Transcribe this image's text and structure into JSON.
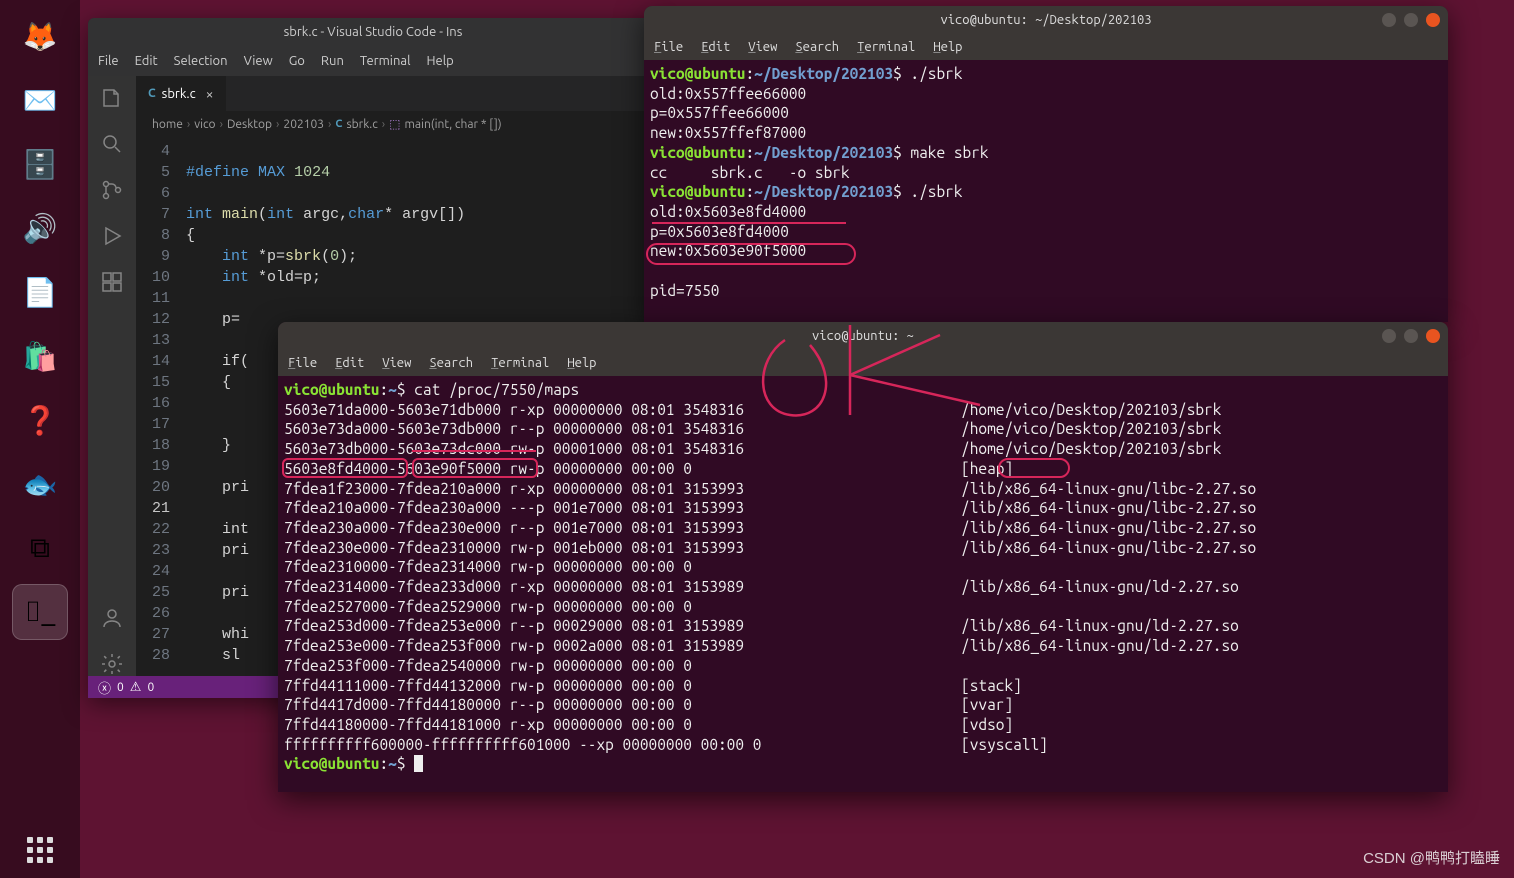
{
  "dock": {
    "items": [
      {
        "name": "firefox",
        "glyph": "🦊"
      },
      {
        "name": "thunderbird",
        "glyph": "✉️"
      },
      {
        "name": "files",
        "glyph": "🗄️"
      },
      {
        "name": "rhythmbox",
        "glyph": "🔊"
      },
      {
        "name": "libreoffice-writer",
        "glyph": "📄"
      },
      {
        "name": "software",
        "glyph": "🛍️"
      },
      {
        "name": "help",
        "glyph": "❓"
      },
      {
        "name": "bluefish",
        "glyph": "🐟"
      },
      {
        "name": "vscode",
        "glyph": "⧉"
      },
      {
        "name": "terminal",
        "glyph": "⌷_"
      }
    ]
  },
  "vscode": {
    "title": "sbrk.c - Visual Studio Code - Ins",
    "menus": [
      "File",
      "Edit",
      "Selection",
      "View",
      "Go",
      "Run",
      "Terminal",
      "Help"
    ],
    "tab_label": "sbrk.c",
    "breadcrumbs": [
      "home",
      "vico",
      "Desktop",
      "202103",
      "sbrk.c",
      "main(int, char * [])"
    ],
    "lines": [
      "4",
      "5",
      "6",
      "7",
      "8",
      "9",
      "10",
      "11",
      "12",
      "13",
      "14",
      "15",
      "16",
      "17",
      "18",
      "19",
      "20",
      "21",
      "22",
      "23",
      "24",
      "25",
      "26",
      "27",
      "28"
    ],
    "code": {
      "l5_define": "#define",
      "l5_mac": "MAX",
      "l5_val": "1024",
      "l7_int": "int",
      "l7_main": "main",
      "l7_sig1": "(",
      "l7_sig_int": "int",
      "l7_argc": " argc,",
      "l7_char": "char",
      "l7_argv": "* argv[])",
      "l8_brace": "{",
      "l9": "    int *p=sbrk(0);",
      "l10": "    int *old=p;",
      "l12_p": "    p=",
      "l14_if": "    if(",
      "l15_b": "    {",
      "l18_b": "    }",
      "l20_pri": "    pri",
      "l22_int": "    int",
      "l23_pri": "    pri",
      "l25_pri": "    pri",
      "l27_whi": "    whi",
      "l28_s": "    sl"
    },
    "status": {
      "errors": "0",
      "warnings": "0"
    }
  },
  "term1": {
    "title": "vico@ubuntu: ~/Desktop/202103",
    "menus": [
      "File",
      "Edit",
      "View",
      "Search",
      "Terminal",
      "Help"
    ],
    "lines": [
      {
        "t": "prompt",
        "path": "~/Desktop/202103",
        "cmd": " ./sbrk"
      },
      {
        "t": "out",
        "text": "old:0x557ffee66000"
      },
      {
        "t": "out",
        "text": "p=0x557ffee66000"
      },
      {
        "t": "out",
        "text": "new:0x557ffef87000"
      },
      {
        "t": "prompt",
        "path": "~/Desktop/202103",
        "cmd": " make sbrk"
      },
      {
        "t": "out",
        "text": "cc     sbrk.c   -o sbrk"
      },
      {
        "t": "prompt",
        "path": "~/Desktop/202103",
        "cmd": " ./sbrk"
      },
      {
        "t": "out",
        "text": "old:0x5603e8fd4000"
      },
      {
        "t": "out",
        "text": "p=0x5603e8fd4000"
      },
      {
        "t": "out",
        "text": "new:0x5603e90f5000"
      },
      {
        "t": "out",
        "text": ""
      },
      {
        "t": "out",
        "text": "pid=7550"
      }
    ]
  },
  "term2": {
    "title": "vico@ubuntu: ~",
    "menus": [
      "File",
      "Edit",
      "View",
      "Search",
      "Terminal",
      "Help"
    ],
    "prompt_cmd": " cat /proc/7550/maps",
    "rows": [
      {
        "range": "5603e71da000-5603e71db000",
        "perm": "r-xp",
        "off": "00000000",
        "dev": "08:01",
        "inode": "3548316",
        "path": "/home/vico/Desktop/202103/sbrk"
      },
      {
        "range": "5603e73da000-5603e73db000",
        "perm": "r--p",
        "off": "00000000",
        "dev": "08:01",
        "inode": "3548316",
        "path": "/home/vico/Desktop/202103/sbrk"
      },
      {
        "range": "5603e73db000-5603e73dc000",
        "perm": "rw-p",
        "off": "00001000",
        "dev": "08:01",
        "inode": "3548316",
        "path": "/home/vico/Desktop/202103/sbrk"
      },
      {
        "range": "5603e8fd4000-5603e90f5000",
        "perm": "rw-p",
        "off": "00000000",
        "dev": "00:00",
        "inode": "0",
        "path": "[heap]"
      },
      {
        "range": "7fdea1f23000-7fdea210a000",
        "perm": "r-xp",
        "off": "00000000",
        "dev": "08:01",
        "inode": "3153993",
        "path": "/lib/x86_64-linux-gnu/libc-2.27.so"
      },
      {
        "range": "7fdea210a000-7fdea230a000",
        "perm": "---p",
        "off": "001e7000",
        "dev": "08:01",
        "inode": "3153993",
        "path": "/lib/x86_64-linux-gnu/libc-2.27.so"
      },
      {
        "range": "7fdea230a000-7fdea230e000",
        "perm": "r--p",
        "off": "001e7000",
        "dev": "08:01",
        "inode": "3153993",
        "path": "/lib/x86_64-linux-gnu/libc-2.27.so"
      },
      {
        "range": "7fdea230e000-7fdea2310000",
        "perm": "rw-p",
        "off": "001eb000",
        "dev": "08:01",
        "inode": "3153993",
        "path": "/lib/x86_64-linux-gnu/libc-2.27.so"
      },
      {
        "range": "7fdea2310000-7fdea2314000",
        "perm": "rw-p",
        "off": "00000000",
        "dev": "00:00",
        "inode": "0",
        "path": ""
      },
      {
        "range": "7fdea2314000-7fdea233d000",
        "perm": "r-xp",
        "off": "00000000",
        "dev": "08:01",
        "inode": "3153989",
        "path": "/lib/x86_64-linux-gnu/ld-2.27.so"
      },
      {
        "range": "7fdea2527000-7fdea2529000",
        "perm": "rw-p",
        "off": "00000000",
        "dev": "00:00",
        "inode": "0",
        "path": ""
      },
      {
        "range": "7fdea253d000-7fdea253e000",
        "perm": "r--p",
        "off": "00029000",
        "dev": "08:01",
        "inode": "3153989",
        "path": "/lib/x86_64-linux-gnu/ld-2.27.so"
      },
      {
        "range": "7fdea253e000-7fdea253f000",
        "perm": "rw-p",
        "off": "0002a000",
        "dev": "08:01",
        "inode": "3153989",
        "path": "/lib/x86_64-linux-gnu/ld-2.27.so"
      },
      {
        "range": "7fdea253f000-7fdea2540000",
        "perm": "rw-p",
        "off": "00000000",
        "dev": "00:00",
        "inode": "0",
        "path": ""
      },
      {
        "range": "7ffd44111000-7ffd44132000",
        "perm": "rw-p",
        "off": "00000000",
        "dev": "00:00",
        "inode": "0",
        "path": "[stack]"
      },
      {
        "range": "7ffd4417d000-7ffd44180000",
        "perm": "r--p",
        "off": "00000000",
        "dev": "00:00",
        "inode": "0",
        "path": "[vvar]"
      },
      {
        "range": "7ffd44180000-7ffd44181000",
        "perm": "r-xp",
        "off": "00000000",
        "dev": "00:00",
        "inode": "0",
        "path": "[vdso]"
      },
      {
        "range": "ffffffffff600000-ffffffffff601000",
        "perm": "--xp",
        "off": "00000000",
        "dev": "00:00",
        "inode": "0",
        "path": "[vsyscall]"
      }
    ]
  },
  "watermark": "CSDN @鸭鸭打瞌睡"
}
